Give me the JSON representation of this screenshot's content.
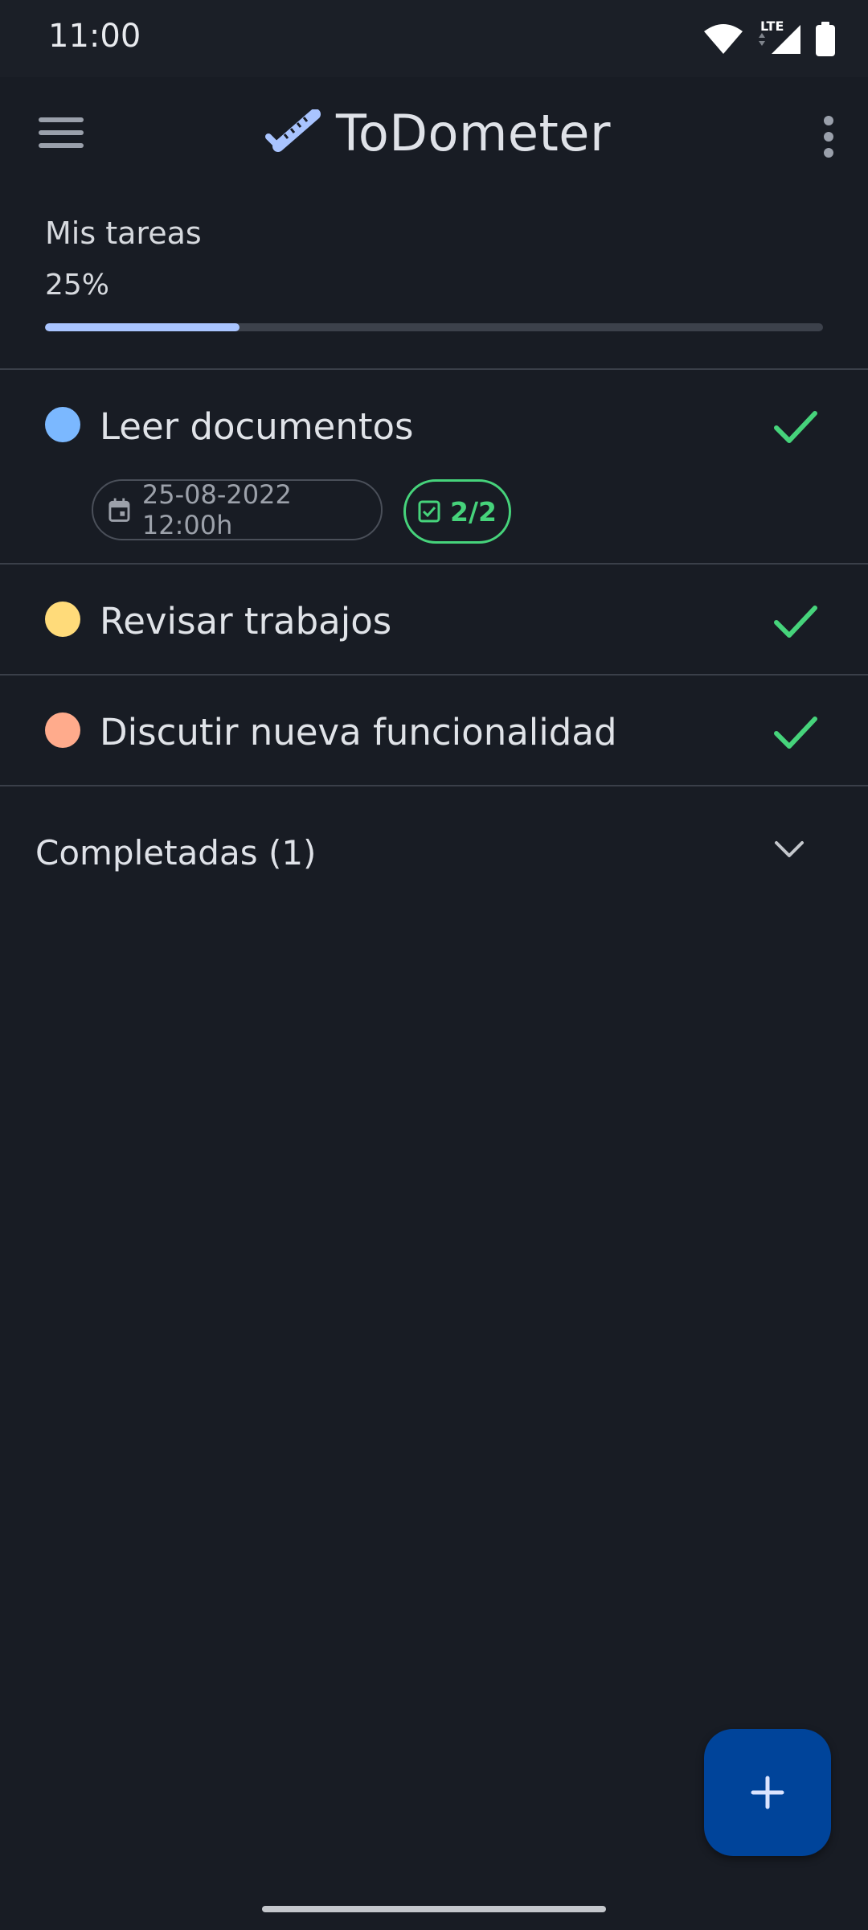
{
  "status_bar": {
    "time": "11:00",
    "network": "LTE"
  },
  "app_bar": {
    "title": "ToDometer",
    "logo_icon": "ruler-check-icon",
    "menu_icon": "hamburger-menu-icon",
    "more_icon": "more-vert-icon"
  },
  "list": {
    "name": "Mis tareas",
    "progress_text": "25%",
    "progress_fraction": 0.25,
    "accent_color": "#a9c4ff"
  },
  "tasks": [
    {
      "name": "Leer documentos",
      "color": "#7bb8ff",
      "due_date": "25-08-2022 12:00h",
      "subtasks": "2/2"
    },
    {
      "name": "Revisar trabajos",
      "color": "#ffdb7a"
    },
    {
      "name": "Discutir nueva funcionalidad",
      "color": "#ffab8c"
    }
  ],
  "completed": {
    "label": "Completadas (1)"
  },
  "fab": {
    "icon": "plus-icon"
  },
  "colors": {
    "background": "#181c24",
    "check_green": "#46d37b",
    "fab": "#00449a"
  }
}
